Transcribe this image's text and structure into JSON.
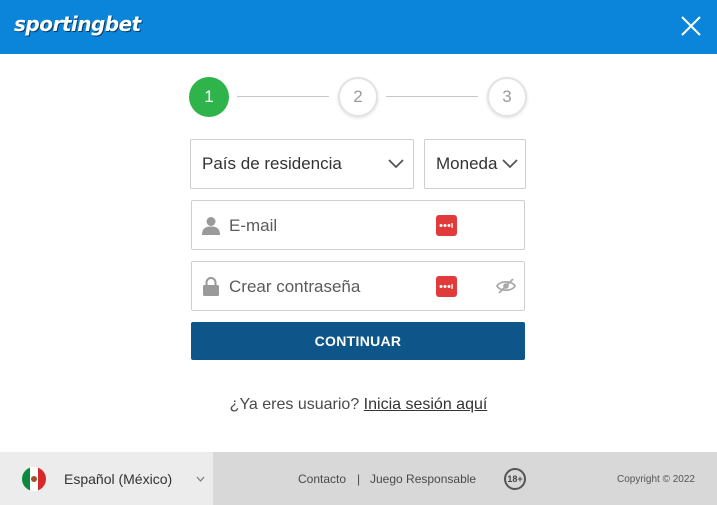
{
  "header": {
    "logo_text": "sportingbet",
    "close_icon": "close-icon",
    "background_color": "#0a85d9"
  },
  "stepper": {
    "steps": [
      "1",
      "2",
      "3"
    ],
    "active_step": 1,
    "active_color": "#2eb44a"
  },
  "form": {
    "country_select": {
      "value": "País de residencia"
    },
    "currency_select": {
      "value": "Moneda"
    },
    "email": {
      "placeholder": "E-mail",
      "icon": "user-icon"
    },
    "password": {
      "placeholder": "Crear contraseña",
      "icon": "lock-icon",
      "toggle_icon": "eye-slash-icon"
    },
    "password_manager_icon": "password-manager-icon",
    "submit_label": "CONTINUAR",
    "submit_color": "#0e5689"
  },
  "login": {
    "prompt": "¿Ya eres usuario?",
    "link_label": "Inicia sesión aquí"
  },
  "footer": {
    "language": "Español (México)",
    "flag_icon": "mexico-flag-icon",
    "links": [
      "Contacto",
      "Juego Responsable"
    ],
    "separator": "|",
    "age_badge": "18+",
    "copyright": "Copyright © 2022"
  }
}
